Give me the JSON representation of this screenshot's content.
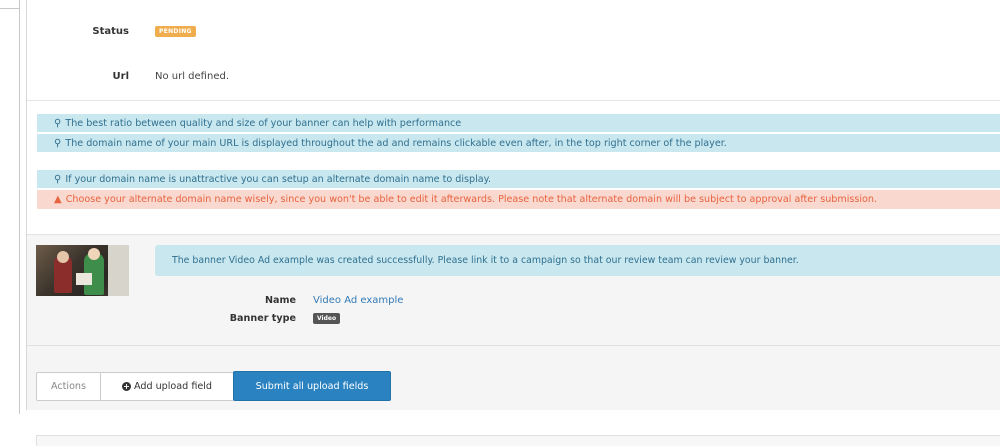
{
  "fields": {
    "status": {
      "label": "Status",
      "value": "PENDING"
    },
    "url": {
      "label": "Url",
      "value": "No url defined."
    }
  },
  "tips": [
    {
      "icon": "lightbulb-icon",
      "text": "The best ratio between quality and size of your banner can help with performance"
    },
    {
      "icon": "lightbulb-icon",
      "text": "The domain name of your main URL is displayed throughout the ad and remains clickable even after, in the top right corner of the player."
    },
    {
      "icon": "lightbulb-icon",
      "text": "If your domain name is unattractive you can setup an alternate domain name to display."
    }
  ],
  "warning": {
    "icon": "warning-icon",
    "text": "Choose your alternate domain name wisely, since you won't be able to edit it afterwards. Please note that alternate domain will be subject to approval after submission."
  },
  "banner": {
    "success_message": "The banner Video Ad example was created successfully. Please link it to a campaign so that our review team can review your banner.",
    "name_label": "Name",
    "name_value": "Video Ad example",
    "type_label": "Banner type",
    "type_value": "Video"
  },
  "actions": {
    "actions_label": "Actions",
    "add_upload_label": "Add upload field",
    "submit_label": "Submit all upload fields"
  },
  "colors": {
    "info_bg": "#c8e7ef",
    "info_text": "#31708f",
    "warning_bg": "#f8d8cf",
    "warning_text": "#e8633f",
    "pending_badge": "#f0ad4e",
    "primary_button": "#2a82c0"
  }
}
